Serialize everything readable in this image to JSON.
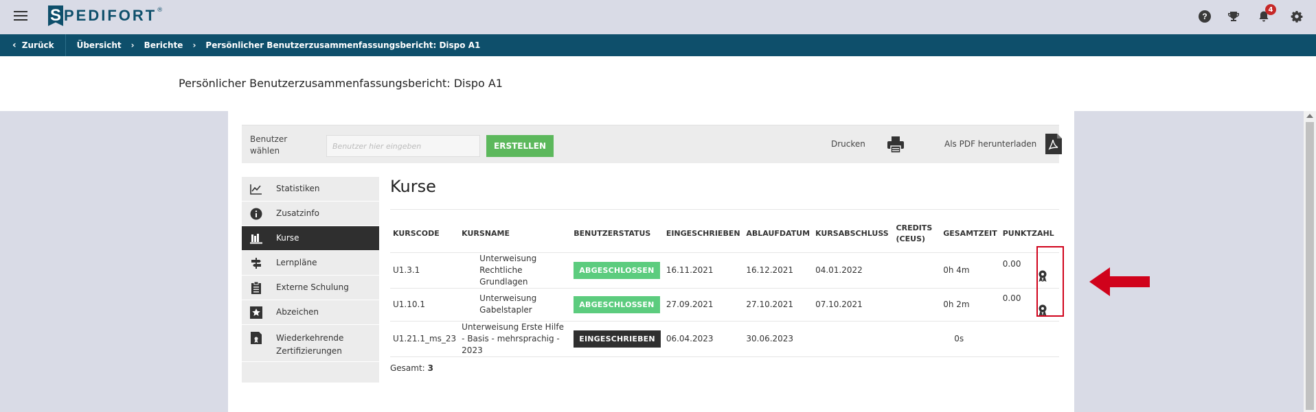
{
  "brand": {
    "logo_letter": "S",
    "logo_rest": "PEDIFORT",
    "logo_mark": "®"
  },
  "header": {
    "notification_count": "4",
    "help_glyph": "?",
    "icons": [
      "menu-icon",
      "help-icon",
      "trophy-icon",
      "bell-icon",
      "gear-icon"
    ]
  },
  "breadcrumb": {
    "back_label": "Zurück",
    "items": [
      "Übersicht",
      "Berichte",
      "Persönlicher Benutzerzusammenfassungsbericht: Dispo A1"
    ]
  },
  "page_title": "Persönlicher Benutzerzusammenfassungsbericht: Dispo A1",
  "toolbar": {
    "select_user_label": "Benutzer wählen",
    "user_input_placeholder": "Benutzer hier eingeben",
    "create_label": "ERSTELLEN",
    "print_label": "Drucken",
    "pdf_label": "Als PDF herunterladen"
  },
  "sidebar": {
    "items": [
      {
        "label": "Statistiken",
        "icon": "chart-icon"
      },
      {
        "label": "Zusatzinfo",
        "icon": "info-icon"
      },
      {
        "label": "Kurse",
        "icon": "courses-icon",
        "active": true
      },
      {
        "label": "Lernpläne",
        "icon": "signpost-icon"
      },
      {
        "label": "Externe Schulung",
        "icon": "clipboard-icon"
      },
      {
        "label": "Abzeichen",
        "icon": "star-icon"
      },
      {
        "label": "Wiederkehrende Zertifizierungen",
        "icon": "certificate-icon"
      }
    ]
  },
  "courses": {
    "title": "Kurse",
    "columns": {
      "code": "KURSCODE",
      "name": "KURSNAME",
      "status": "BENUTZERSTATUS",
      "enrolled": "EINGESCHRIEBEN",
      "expiry": "ABLAUFDATUM",
      "completion": "KURSABSCHLUSS",
      "credits": "CREDITS (CEUS)",
      "total_time": "GESAMTZEIT",
      "score": "PUNKTZAHL"
    },
    "rows": [
      {
        "code": "U1.3.1",
        "name": "Unterweisung Rechtliche Grundlagen",
        "status": "ABGESCHLOSSEN",
        "status_type": "done",
        "enrolled": "16.11.2021",
        "expiry": "16.12.2021",
        "completion": "04.01.2022",
        "credits": "",
        "total_time": "0h 4m",
        "score": "0.00",
        "certificate": true
      },
      {
        "code": "U1.10.1",
        "name": "Unterweisung Gabelstapler",
        "status": "ABGESCHLOSSEN",
        "status_type": "done",
        "enrolled": "27.09.2021",
        "expiry": "27.10.2021",
        "completion": "07.10.2021",
        "credits": "",
        "total_time": "0h 2m",
        "score": "0.00",
        "certificate": true
      },
      {
        "code": "U1.21.1_ms_23",
        "name": "Unterweisung Erste Hilfe - Basis - mehrsprachig - 2023",
        "status": "EINGESCHRIEBEN",
        "status_type": "enrolled",
        "enrolled": "06.04.2023",
        "expiry": "30.06.2023",
        "completion": "",
        "credits": "",
        "total_time": "0s",
        "score": "",
        "certificate": false
      }
    ],
    "total_label": "Gesamt:",
    "total_value": "3"
  },
  "colors": {
    "brand": "#0e4f6b",
    "done": "#5ccc7e",
    "enrolled": "#2f2f2f",
    "create": "#5cb85c",
    "annotation": "#d0021b"
  }
}
